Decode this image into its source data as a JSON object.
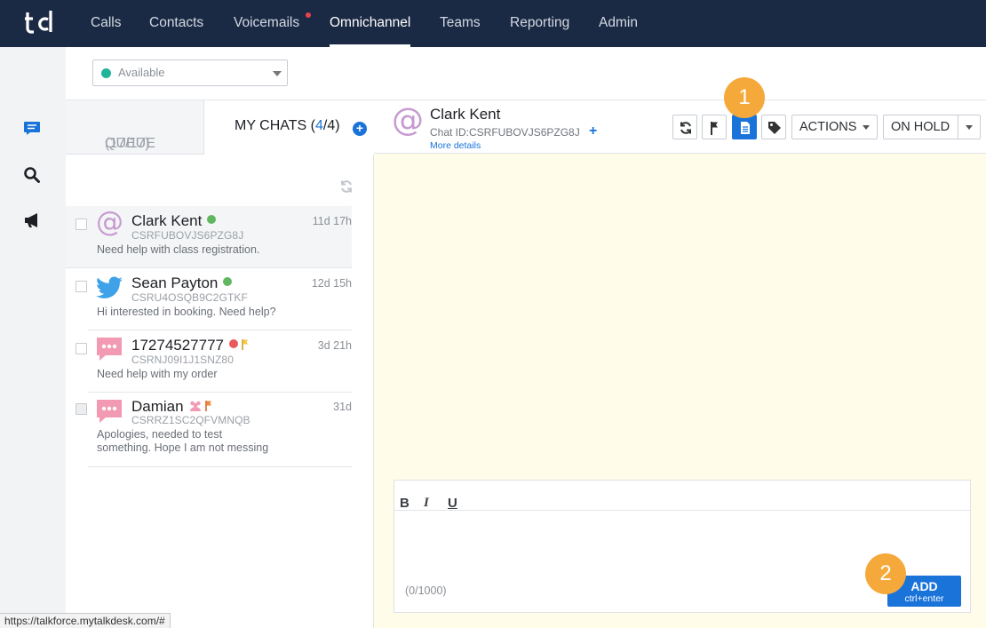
{
  "nav": {
    "items": [
      {
        "label": "Calls"
      },
      {
        "label": "Contacts"
      },
      {
        "label": "Voicemails"
      },
      {
        "label": "Omnichannel"
      },
      {
        "label": "Teams"
      },
      {
        "label": "Reporting"
      },
      {
        "label": "Admin"
      }
    ],
    "active": "Omnichannel",
    "colors": {
      "background": "#1b2a44",
      "notification_dot": "#e8414b"
    }
  },
  "rail": {
    "icons": [
      "chat-icon",
      "search-icon",
      "megaphone-icon"
    ]
  },
  "status": {
    "value": "Available",
    "color": "#1fb59a"
  },
  "tabs": {
    "queue": {
      "label": "QUEUE",
      "count": "(17/17)"
    },
    "my_chats": {
      "label": "MY CHATS",
      "count_open": "(",
      "count_a": "4",
      "count_b": "/4)"
    }
  },
  "chats": [
    {
      "name": "Clark Kent",
      "id": "CSRFUBOVJS6PZG8J",
      "message": "Need help with class registration.",
      "time": "11d 17h",
      "channel": "email",
      "status": "online"
    },
    {
      "name": "Sean Payton",
      "id": "CSRU4OSQB9C2GTKF",
      "message": "Hi interested in booking. Need help?",
      "time": "12d 15h",
      "channel": "twitter",
      "status": "online"
    },
    {
      "name": "17274527777",
      "id": "CSRNJ09I1J1SNZ80",
      "message": "Need help with my order",
      "time": "3d 21h",
      "channel": "sms",
      "status": "offline",
      "flag": "yellow"
    },
    {
      "name": "Damian",
      "id": "CSRRZ1SC2QFVMNQB",
      "message_line1": "Apologies, needed to test",
      "message_line2": "something. Hope I am not messing",
      "time": "31d",
      "channel": "sms",
      "flag": "orange"
    }
  ],
  "conversation": {
    "name": "Clark Kent",
    "chat_id": "Chat ID:CSRFUBOVJS6PZG8J",
    "more_details": "More details",
    "actions_label": "ACTIONS",
    "on_hold_label": "ON HOLD"
  },
  "editor": {
    "bold": "B",
    "italic": "I",
    "underline": "U",
    "counter": "(0/1000)",
    "add_label": "ADD",
    "add_hint": "ctrl+enter"
  },
  "badges": [
    "1",
    "2"
  ],
  "status_url": "https://talkforce.mytalkdesk.com/#",
  "colors": {
    "accent": "#1a73d9",
    "badge": "#f6a93b",
    "conversation_bg": "#fffdea"
  }
}
